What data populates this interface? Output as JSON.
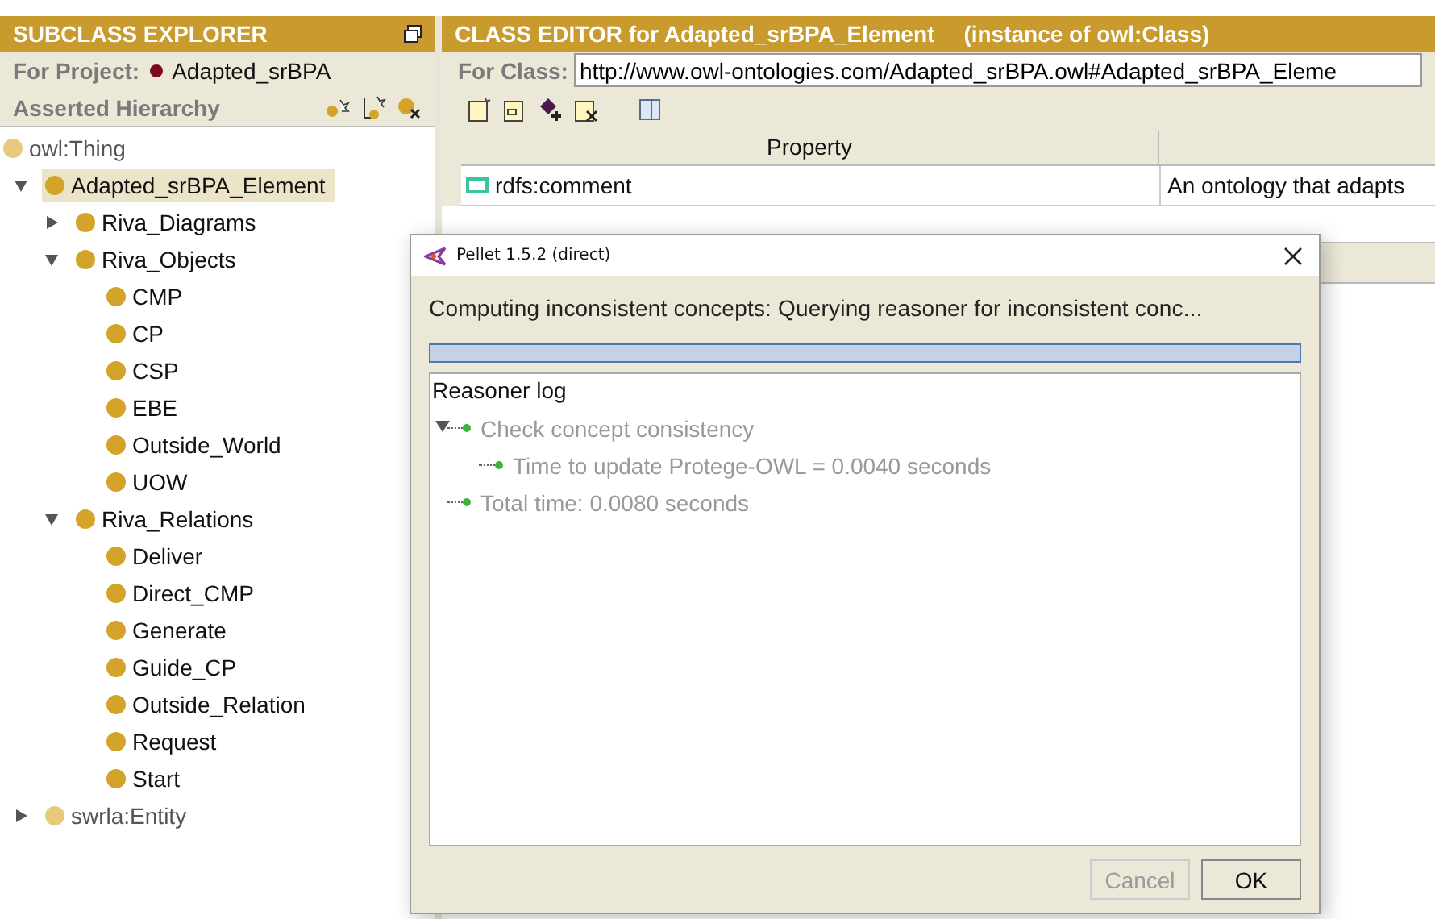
{
  "explorer": {
    "title": "SUBCLASS EXPLORER",
    "project_label": "For Project:",
    "project_name": "Adapted_srBPA",
    "hierarchy_label": "Asserted Hierarchy",
    "tree": [
      {
        "label": "owl:Thing",
        "kind": "system",
        "selected": false
      },
      {
        "label": "Adapted_srBPA_Element",
        "kind": "class",
        "selected": true,
        "expanded": true,
        "children": [
          {
            "label": "Riva_Diagrams",
            "kind": "class",
            "selected": false,
            "expanded": false
          },
          {
            "label": "Riva_Objects",
            "kind": "class",
            "selected": false,
            "expanded": true,
            "children": [
              {
                "label": "CMP",
                "kind": "class",
                "selected": false
              },
              {
                "label": "CP",
                "kind": "class",
                "selected": false
              },
              {
                "label": "CSP",
                "kind": "class",
                "selected": false
              },
              {
                "label": "EBE",
                "kind": "class",
                "selected": false
              },
              {
                "label": "Outside_World",
                "kind": "class",
                "selected": false
              },
              {
                "label": "UOW",
                "kind": "class",
                "selected": false
              }
            ]
          },
          {
            "label": "Riva_Relations",
            "kind": "class",
            "selected": false,
            "expanded": true,
            "children": [
              {
                "label": "Deliver",
                "kind": "class",
                "selected": false
              },
              {
                "label": "Direct_CMP",
                "kind": "class",
                "selected": false
              },
              {
                "label": "Generate",
                "kind": "class",
                "selected": false
              },
              {
                "label": "Guide_CP",
                "kind": "class",
                "selected": false
              },
              {
                "label": "Outside_Relation",
                "kind": "class",
                "selected": false
              },
              {
                "label": "Request",
                "kind": "class",
                "selected": false
              },
              {
                "label": "Start",
                "kind": "class",
                "selected": false
              }
            ]
          }
        ]
      },
      {
        "label": "swrla:Entity",
        "kind": "system",
        "selected": false,
        "expanded": false
      }
    ]
  },
  "editor": {
    "title": "CLASS EDITOR for Adapted_srBPA_Element",
    "subtitle": "(instance of owl:Class)",
    "class_label": "For Class:",
    "class_uri": "http://www.owl-ontologies.com/Adapted_srBPA.owl#Adapted_srBPA_Eleme",
    "columns": [
      "Property"
    ],
    "rows": [
      {
        "property": "rdfs:comment",
        "value": "An ontology that adapts"
      }
    ]
  },
  "dialog": {
    "title": "Pellet 1.5.2 (direct)",
    "message": "Computing inconsistent concepts: Querying reasoner for inconsistent conc...",
    "progress": {
      "level": 1
    },
    "log_title": "Reasoner log",
    "log": [
      {
        "text": "Check concept consistency",
        "expanded": true,
        "children": [
          {
            "text": "Time to update Protege-OWL = 0.0040 seconds"
          }
        ]
      },
      {
        "text": "Total time: 0.0080 seconds"
      }
    ],
    "buttons": [
      {
        "label": "Cancel",
        "disabled": true
      },
      {
        "label": "OK",
        "disabled": false
      }
    ]
  }
}
